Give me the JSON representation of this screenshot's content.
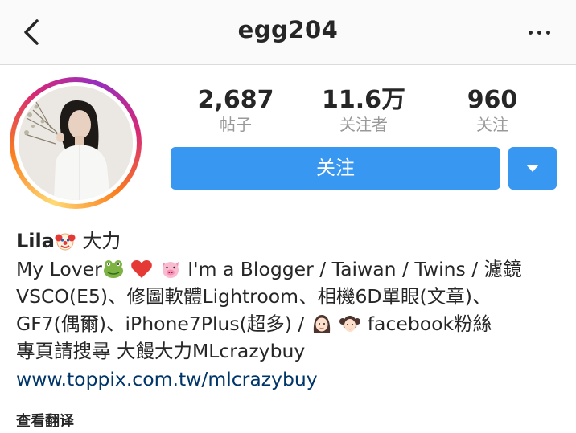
{
  "header": {
    "username": "egg204",
    "back_icon": "chevron-left-icon",
    "more_icon": "more-horizontal-icon"
  },
  "profile": {
    "stats": [
      {
        "value": "2,687",
        "label": "帖子"
      },
      {
        "value": "11.6万",
        "label": "关注者"
      },
      {
        "value": "960",
        "label": "关注"
      }
    ],
    "follow_label": "关注",
    "dropdown_icon": "caret-down-icon",
    "accent_color": "#3897f0"
  },
  "bio": {
    "name": "Lila",
    "name_suffix": "大力",
    "lines": [
      {
        "pre": "My Lover",
        "post": " I'm a Blogger / Taiwan / Twins / 濾鏡"
      },
      {
        "text": "VSCO(E5)、修圖軟體Lightroom、相機6D單眼(文章)、"
      },
      {
        "pre": "GF7(偶爾)、iPhone7Plus(超多) / ",
        "post": " facebook粉絲"
      },
      {
        "text": "專頁請搜尋 大饅大力MLcrazybuy"
      }
    ],
    "link": "www.toppix.com.tw/mlcrazybuy",
    "translate_label": "查看翻译"
  }
}
